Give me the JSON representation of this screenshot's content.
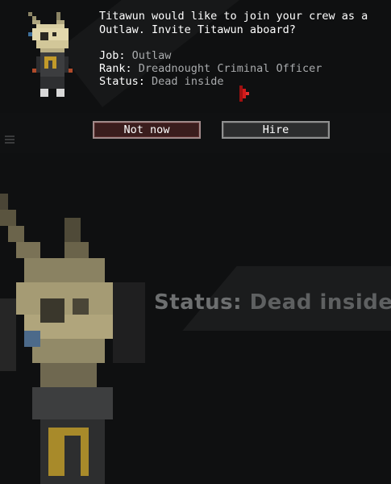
{
  "dialog": {
    "message": "Titawun would like to join your crew as a Outlaw. Invite Titawun aboard?",
    "job_label": "Job:",
    "job_value": "Outlaw",
    "rank_label": "Rank:",
    "rank_value": "Dreadnought Criminal Officer",
    "status_label": "Status:",
    "status_value": "Dead inside",
    "buttons": {
      "decline": "Not now",
      "accept": "Hire"
    }
  },
  "background": {
    "status_label": "Status:",
    "status_value": "Dead inside"
  },
  "colors": {
    "text": "#ffffff",
    "value_text": "#a9abad",
    "decline_bg": "#3a1d1d",
    "accept_bg": "#2c2d2e",
    "cursor": "#d11a1a"
  },
  "icons": {
    "portrait": "skull-masked-outlaw-sprite",
    "cursor": "red-arrow-cursor"
  }
}
